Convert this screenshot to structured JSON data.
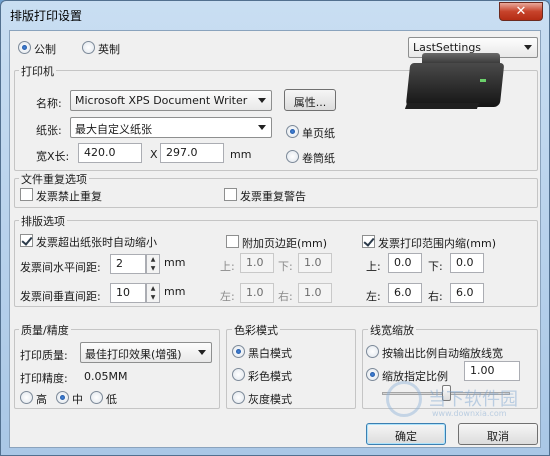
{
  "window": {
    "title": "排版打印设置",
    "close": "✕"
  },
  "units": {
    "metric": "公制",
    "imperial": "英制",
    "selected": "metric"
  },
  "settings_preset": "LastSettings",
  "printer": {
    "group": "打印机",
    "name_label": "名称:",
    "name": "Microsoft XPS Document Writer",
    "properties": "属性...",
    "paper_label": "纸张:",
    "paper": "最大自定义纸张",
    "size_label": "宽X长:",
    "width": "420.0",
    "x": "X",
    "length": "297.0",
    "unit": "mm",
    "single_sheet": "单页纸",
    "roll_paper": "卷筒纸"
  },
  "repeat": {
    "group": "文件重复选项",
    "forbid": "发票禁止重复",
    "warn": "发票重复警告"
  },
  "layout": {
    "group": "排版选项",
    "auto_shrink": "发票超出纸张时自动缩小",
    "h_spacing_label": "发票间水平间距:",
    "h_spacing": "2",
    "v_spacing_label": "发票间垂直间距:",
    "v_spacing": "10",
    "unit_mm": "mm",
    "page_margin": "附加页边距(mm)",
    "pm_top_label": "上:",
    "pm_top": "1.0",
    "pm_bottom_label": "下:",
    "pm_bottom": "1.0",
    "pm_left_label": "左:",
    "pm_left": "1.0",
    "pm_right_label": "右:",
    "pm_right": "1.0",
    "print_shrink": "发票打印范围内缩(mm)",
    "ps_top_label": "上:",
    "ps_top": "0.0",
    "ps_bottom_label": "下:",
    "ps_bottom": "0.0",
    "ps_left_label": "左:",
    "ps_left": "6.0",
    "ps_right_label": "右:",
    "ps_right": "6.0"
  },
  "quality": {
    "group": "质量/精度",
    "quality_label": "打印质量:",
    "quality": "最佳打印效果(增强)",
    "precision_label": "打印精度:",
    "precision": "0.05MM",
    "high": "高",
    "mid": "中",
    "low": "低"
  },
  "color": {
    "group": "色彩模式",
    "bw": "黑白模式",
    "color": "彩色模式",
    "gray": "灰度模式"
  },
  "linewidth": {
    "group": "线宽缩放",
    "auto": "按输出比例自动缩放线宽",
    "fixed": "缩放指定比例",
    "ratio": "1.00"
  },
  "buttons": {
    "ok": "确定",
    "cancel": "取消"
  },
  "watermark": {
    "text": "当下软件园",
    "sub": "www.downxia.com"
  }
}
